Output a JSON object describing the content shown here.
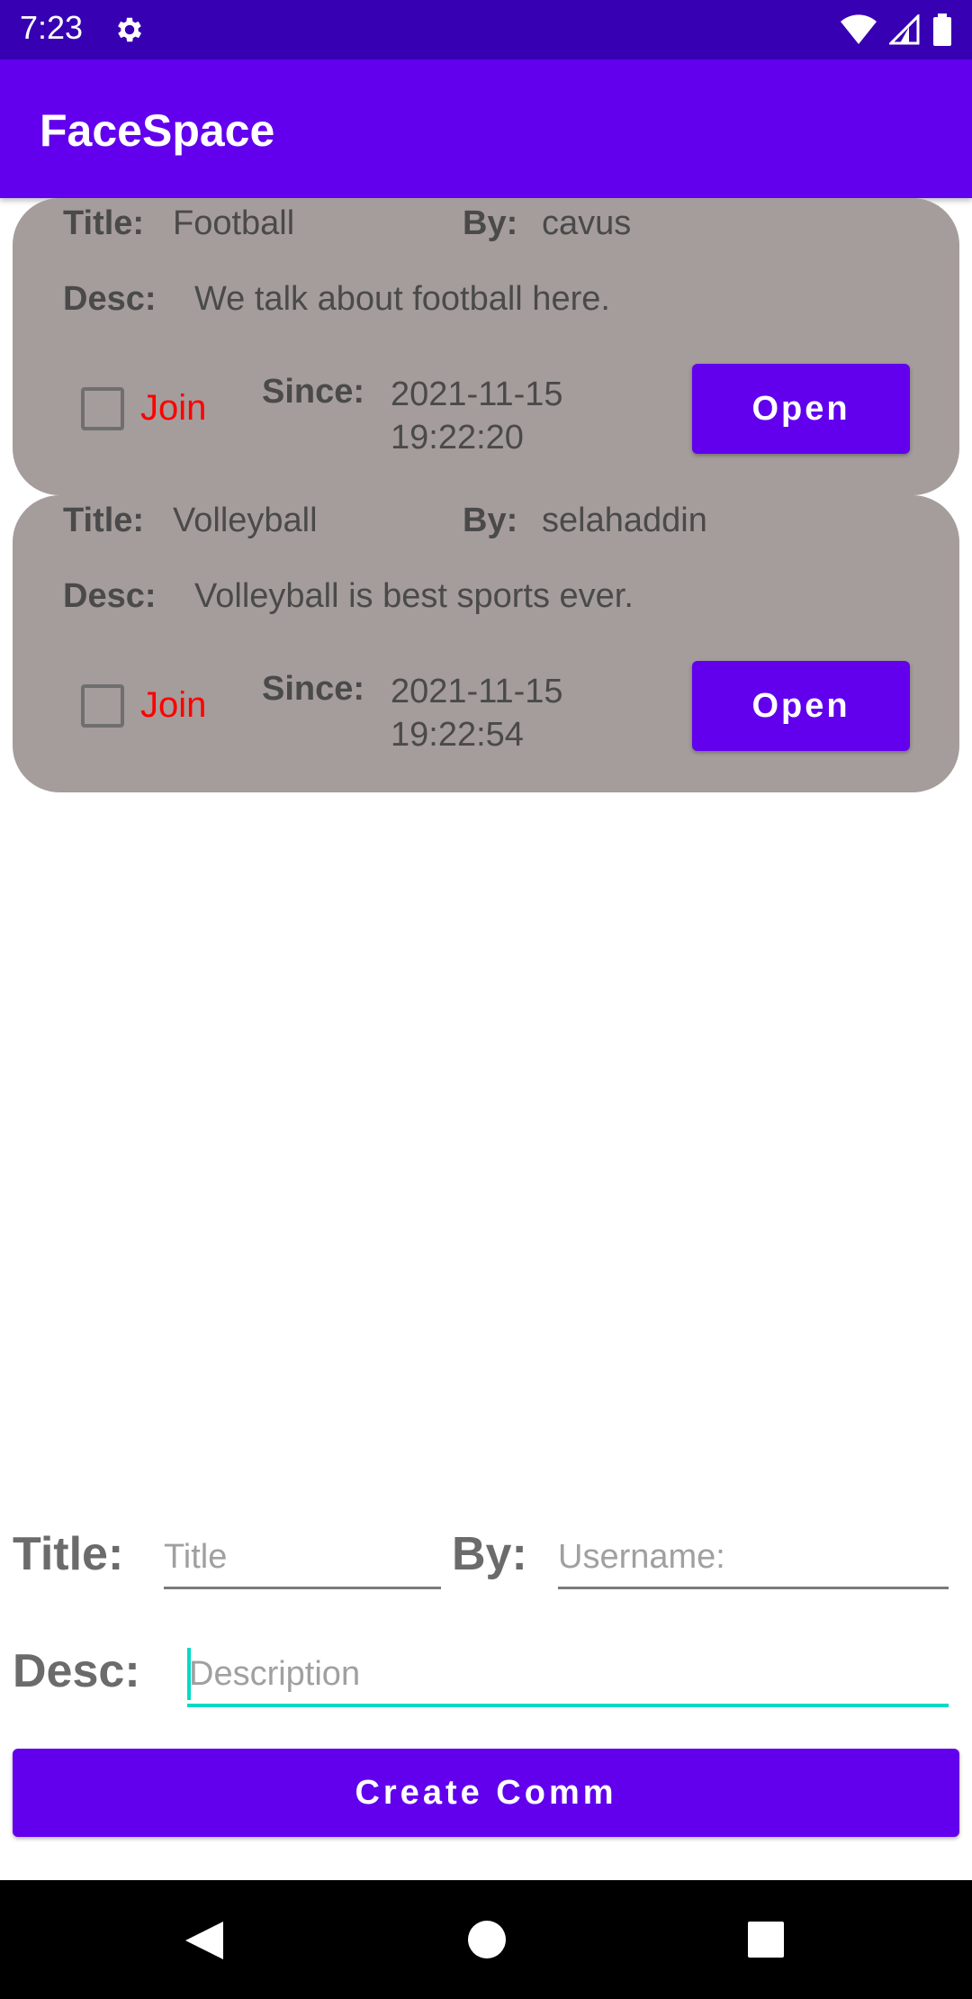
{
  "status_bar": {
    "time": "7:23",
    "icons": [
      "gear-icon",
      "wifi-icon",
      "signal-icon",
      "battery-icon"
    ]
  },
  "app_bar": {
    "title": "FaceSpace"
  },
  "communities": [
    {
      "title_label": "Title:",
      "title": "Football",
      "by_label": "By:",
      "by": "cavus",
      "desc_label": "Desc:",
      "desc": "We talk about football here.",
      "join_label": "Join",
      "joined": false,
      "since_label": "Since:",
      "since_date": "2021-11-15",
      "since_time": "19:22:20",
      "open_label": "Open"
    },
    {
      "title_label": "Title:",
      "title": "Volleyball",
      "by_label": "By:",
      "by": "selahaddin",
      "desc_label": "Desc:",
      "desc": "Volleyball is best sports ever.",
      "join_label": "Join",
      "joined": false,
      "since_label": "Since:",
      "since_date": "2021-11-15",
      "since_time": "19:22:54",
      "open_label": "Open"
    }
  ],
  "form": {
    "title_label": "Title:",
    "title_value": "",
    "title_placeholder": "Title",
    "by_label": "By:",
    "by_value": "",
    "by_placeholder": "Username:",
    "desc_label": "Desc:",
    "desc_value": "",
    "desc_placeholder": "Description",
    "create_label": "Create Comm"
  },
  "nav_bar": {
    "icons": [
      "back-icon",
      "home-icon",
      "recents-icon"
    ]
  },
  "colors": {
    "primary": "#6200ee",
    "primary_dark": "#3700b3",
    "card": "#a59d9b",
    "join_text": "#ff0000",
    "accent": "#03dac5"
  }
}
